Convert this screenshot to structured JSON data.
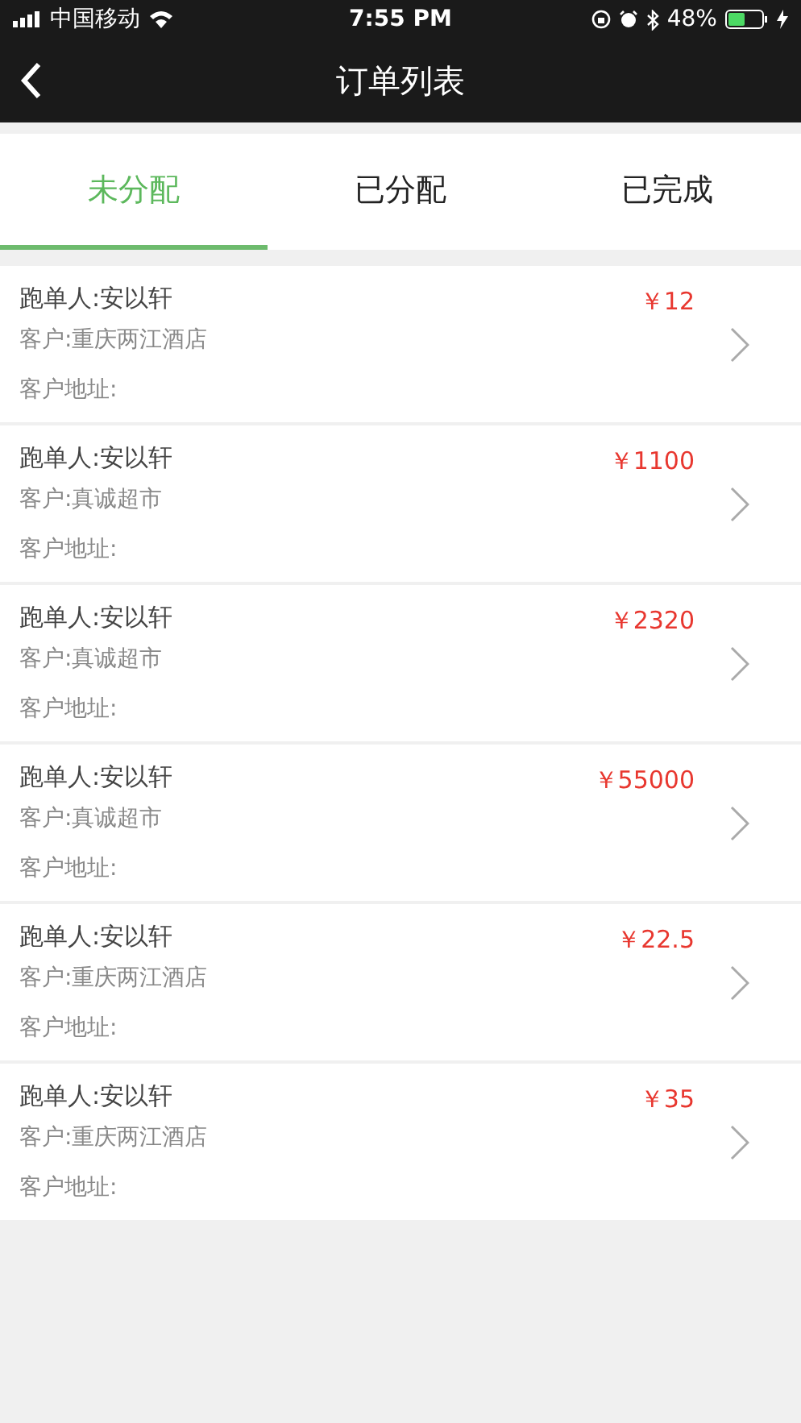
{
  "status_bar": {
    "carrier": "中国移动",
    "time": "7:55 PM",
    "battery": "48%"
  },
  "nav_bar": {
    "title": "订单列表"
  },
  "tabs": [
    {
      "label": "未分配",
      "selected": true
    },
    {
      "label": "已分配",
      "selected": false
    },
    {
      "label": "已完成",
      "selected": false
    }
  ],
  "orders": [
    {
      "runner": "跑单人:安以轩",
      "customer": "客户:重庆两江酒店",
      "address": "客户地址:",
      "price": "￥12"
    },
    {
      "runner": "跑单人:安以轩",
      "customer": "客户:真诚超市",
      "address": "客户地址:",
      "price": "￥1100"
    },
    {
      "runner": "跑单人:安以轩",
      "customer": "客户:真诚超市",
      "address": "客户地址:",
      "price": "￥2320"
    },
    {
      "runner": "跑单人:安以轩",
      "customer": "客户:真诚超市",
      "address": "客户地址:",
      "price": "￥55000"
    },
    {
      "runner": "跑单人:安以轩",
      "customer": "客户:重庆两江酒店",
      "address": "客户地址:",
      "price": "￥22.5"
    },
    {
      "runner": "跑单人:安以轩",
      "customer": "客户:重庆两江酒店",
      "address": "客户地址:",
      "price": "￥35"
    }
  ]
}
